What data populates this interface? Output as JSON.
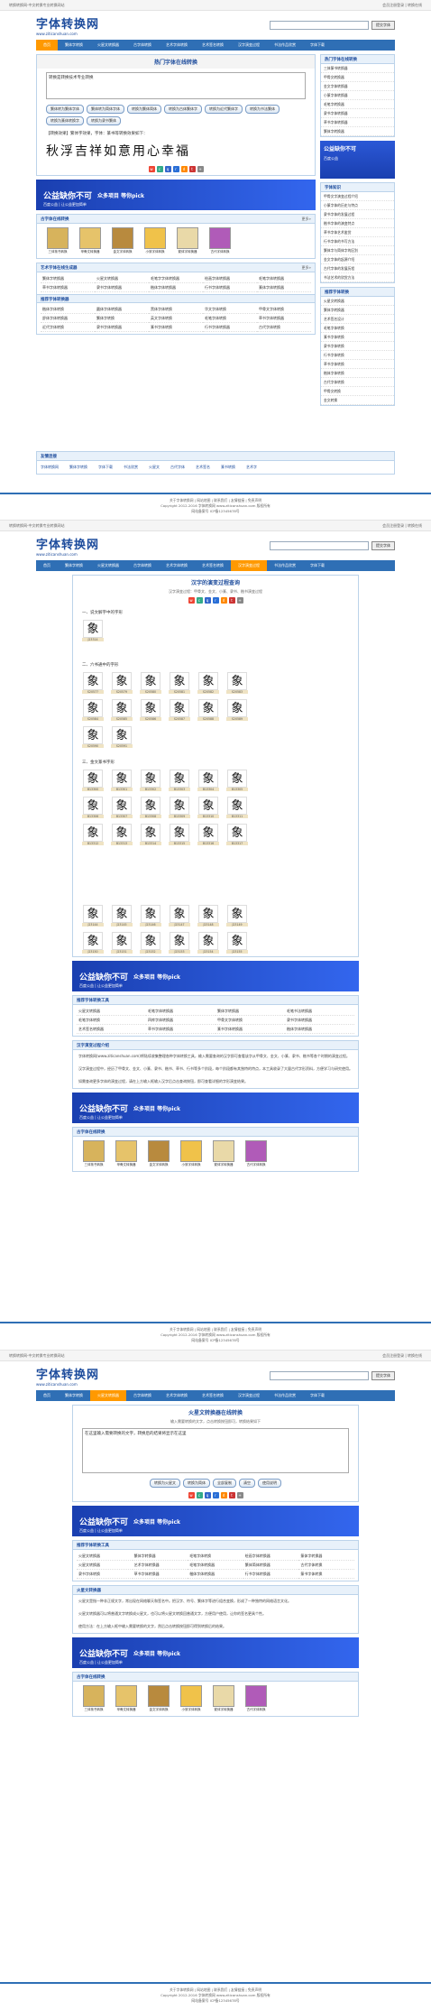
{
  "site": {
    "logo_cn": "字体转换网",
    "logo_en": "www.ziticanshuan.com",
    "topbar_left": "转换转换网-中文转换专业转换网站",
    "topbar_right": "会员注册登录 | 转换在线",
    "search_placeholder": "",
    "search_button": "提交字体"
  },
  "nav": [
    "首页",
    "繁体字转换",
    "火星文转换器",
    "古字体转换",
    "艺术字体转换",
    "艺术签名转换",
    "汉字演变过程",
    "书法作品欣赏",
    "字体下载"
  ],
  "page1": {
    "tool_title": "热门字体在线转换",
    "textarea_value": "转换是转换技术专业转换",
    "buttons": [
      "繁体转为繁体字体",
      "繁体转为简体字体",
      "转换为繁体简体",
      "转换为古体繁体字",
      "转换为近代繁体字",
      "转换为书法繁体",
      "转换为篆体转换字",
      "转换为隶书繁体",
      "转换为草书繁体",
      "转换为行书繁体"
    ],
    "result_label": "【转换效果】繁体字效果，字体：篆书等转换效果如下：",
    "calligraphy": "秋浮吉祥如意用心幸福",
    "ad": {
      "t1": "公益缺你不可",
      "t2": "众多项目 等你pick",
      "t3": "百度公益 | 让公益更加简单"
    },
    "fonts_title": "古字体在线转换",
    "fonts_more": "更多»",
    "thumbs": [
      "三体篆书转换",
      "甲骨文转换器",
      "金文字体转换",
      "小篆字体转换",
      "繁体字转换器",
      "古代字体转换"
    ],
    "art_title": "艺术字体在线生成器",
    "art_more": "更多»",
    "art_items": [
      "繁体字转换器",
      "火星文转换器",
      "毛笔字字体转换器",
      "绘画字体转换器",
      "毛笔字体转换器",
      "草书字体转换器",
      "隶书字体转换器",
      "楷体字体转换器",
      "行书字体转换器",
      "篆体字体转换器"
    ],
    "rec_title": "推荐字体转换器",
    "rec_items": [
      "楷体字体转换",
      "圆体字体转换器",
      "黑体字体转换",
      "华文字体转换",
      "甲骨文字体转换",
      "舒体字体转换器",
      "繁体字转换",
      "英文字体转换",
      "毛笔字体转换",
      "草书字体转换器",
      "近代字体转换",
      "隶书字体转换器",
      "篆书字体转换",
      "行书字体转换器",
      "古代字体转换"
    ],
    "links_title": "友情连接",
    "links": [
      "字体转换网",
      "繁体字转换",
      "字体下载",
      "书法欣赏",
      "火星文",
      "古代字体",
      "艺术签名",
      "篆书转换",
      "艺术字"
    ],
    "side_title": "热门字体在线转换",
    "side_items": [
      "三体篆书转换器",
      "甲骨文转换器",
      "金文字体转换器",
      "小篆字体转换器",
      "毛笔字转换器",
      "隶书字体转换器",
      "草书字体转换器",
      "繁体字转换器",
      "行书字体转换器",
      "篆体字转换器"
    ],
    "side_ad": {
      "t1": "公益缺你不可",
      "t2": "百度公益"
    },
    "side_news_title": "字体知识",
    "side_news": [
      "甲骨文字演变过程介绍",
      "小篆字体的历史与特点",
      "隶书字体的发展过程",
      "楷书字体的演变特点",
      "草书字体艺术鉴赏",
      "行书字体的书写方法",
      "繁体字与简体字的区别",
      "金文字体的起源介绍",
      "古代字体的发展历程",
      "书法艺术的欣赏方法"
    ],
    "side_rec_title": "推荐字体转换",
    "side_rec": [
      "火星文转换器",
      "繁体字转换器",
      "艺术签名设计",
      "毛笔字体转换",
      "篆书字体转换",
      "隶书字体转换",
      "行书字体转换",
      "草书字体转换",
      "楷体字体转换",
      "古代字体转换",
      "甲骨文转换",
      "金文转换"
    ]
  },
  "footer": {
    "line1": "关于字体转换网 | 网站地图 | 联系我们 | 友情链接 | 免责声明",
    "line2": "Copyright 2012-2016 字体转换网 www.ziticanshuan.com 版权所有",
    "line3": "网站备案号 ICP备12345678号"
  },
  "page2": {
    "tool_title": "汉字的演变过程查询",
    "subtitle": "汉字演变过程：甲骨文、金文、小篆、隶书、楷书演变过程",
    "step1": "一、说文解字中的字形",
    "step2": "二、六书通中的字形",
    "step3": "三、金文篆书字形",
    "glyph": "象",
    "codes_step1": [
      "J23314"
    ],
    "codes_step2": [
      "S20577",
      "S20579",
      "S20580",
      "S20581",
      "S20582",
      "S20583",
      "S20584",
      "S20585",
      "S20586",
      "S20587",
      "S20588",
      "S20589",
      "S20590",
      "S20591"
    ],
    "codes_step3": [
      "B13300",
      "B13301",
      "B13302",
      "B13303",
      "B13304",
      "B13305",
      "B13306",
      "B13307",
      "B13308",
      "B13309",
      "B13310",
      "B13311",
      "B13312",
      "B13313",
      "B13314",
      "B13315",
      "B13316",
      "B13317"
    ],
    "codes_step4": [
      "J23144",
      "J23145",
      "J23146",
      "J23147",
      "J23148",
      "J23149",
      "J23150",
      "J23151",
      "J23152",
      "J23153",
      "J23154",
      "J23155"
    ],
    "tools_title": "推荐字体转换工具",
    "tools": [
      "火星文转换器",
      "毛笔字体转换器",
      "繁体字转换器",
      "毛笔书法转换器",
      "毛笔字体转换",
      "四库字体转换器",
      "甲骨文字体转换",
      "隶书字体转换器",
      "艺术签名转换器",
      "草书字体转换器",
      "篆书字体转换器",
      "楷体字体转换器"
    ],
    "about_title": "汉字演变过程介绍",
    "about_p1": "字体转换网(www.ziticanshuan.com)将陆续收集整理各种字体转换工具，输入需要查询的汉字即可查看该字从甲骨文、金文、小篆、隶书、楷书等各个时期的演变过程。",
    "about_p2": "汉字演变过程中，经历了甲骨文、金文、小篆、隶书、楷书、草书、行书等多个阶段，每个阶段都有其独特的特点，本工具收录了大量古代字形资料，方便学习与研究使用。",
    "about_p3": "如需查询更多字体的演变过程，请在上方输入框输入汉字后点击查询按钮，即可查看详细的字形演变结果。",
    "ad": {
      "t1": "公益缺你不可",
      "t2": "众多项目 等你pick",
      "t3": "百度公益 | 让公益更加简单"
    },
    "fonts_title": "古字体在线转换",
    "thumbs": [
      "三体篆书转换",
      "甲骨文转换器",
      "金文字体转换",
      "小篆字体转换",
      "繁体字转换器",
      "古代字体转换"
    ]
  },
  "page3": {
    "tool_title": "火星文转换器在线转换",
    "subtitle": "输入需要转换的文字，点击转换按钮即可，转换结果如下",
    "textarea_value": "在这里输入需要转换的文字，转换后的结果将显示在这里",
    "buttons": [
      "转换为火星文",
      "转换为简体",
      "全部复制",
      "清空",
      "使用说明"
    ],
    "tools_title": "推荐字体转换工具",
    "tools": [
      "火星文转换器",
      "繁体字转换器",
      "毛笔字体转换",
      "绘画字体转换器",
      "篆体字转换器",
      "火星文转换器",
      "艺术字体转换器",
      "毛笔字体转换器",
      "繁体简体转换器",
      "古代字体转换",
      "隶书字体转换",
      "草书字体转换器",
      "楷体字体转换器",
      "行书字体转换器",
      "篆书字体转换"
    ],
    "about_title": "火星文转换器",
    "about_p1": "火星文是指一种非正规文字，常出现在网络聊天和签名中。把汉字、符号、繁体字等进行组合变换，形成了一种独特的网络语言文化。",
    "about_p2": "火星文转换器可以将普通文字转换成火星文，也可以将火星文转换回普通文字，方便用户使用，让你的签名更具个性。",
    "about_p3": "使用方法：在上方输入框中输入需要转换的文字，然后点击转换按钮即可得到转换后的结果。",
    "ad": {
      "t1": "公益缺你不可",
      "t2": "众多项目 等你pick",
      "t3": "百度公益 | 让公益更加简单"
    },
    "fonts_title": "古字体在线转换",
    "thumbs": [
      "三体篆书转换",
      "甲骨文转换器",
      "金文字体转换",
      "小篆字体转换",
      "繁体字转换器",
      "古代字体转换"
    ]
  }
}
